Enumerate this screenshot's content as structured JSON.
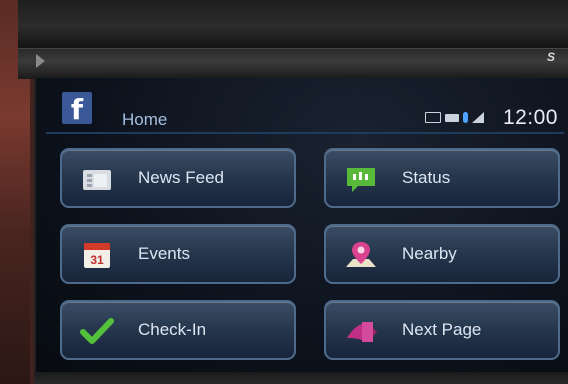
{
  "header": {
    "logo_letter": "f",
    "title": "Home",
    "clock": "12:00"
  },
  "icons": {
    "logo": "facebook-logo",
    "status": [
      "message-icon",
      "battery-icon",
      "bluetooth-icon",
      "signal-icon"
    ]
  },
  "tiles": [
    {
      "label": "News Feed",
      "icon": "news-feed-icon"
    },
    {
      "label": "Status",
      "icon": "status-icon"
    },
    {
      "label": "Events",
      "icon": "calendar-icon",
      "icon_text": "31"
    },
    {
      "label": "Nearby",
      "icon": "nearby-pin-icon"
    },
    {
      "label": "Check-In",
      "icon": "checkmark-icon"
    },
    {
      "label": "Next Page",
      "icon": "next-page-icon"
    }
  ],
  "colors": {
    "facebook_blue": "#3b5998",
    "tile_border": "#4f6b8c",
    "title_text": "#a6bfe0",
    "check_green": "#53c13a",
    "status_green": "#58b93a",
    "calendar_red": "#d23a2a",
    "next_page_magenta": "#c02f86"
  }
}
